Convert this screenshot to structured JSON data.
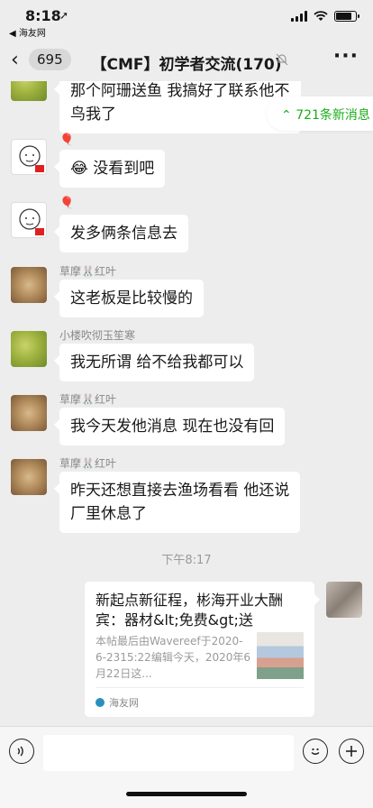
{
  "status_bar": {
    "time": "8:18",
    "location_icon": "location-arrow-icon",
    "back_app": "◀ 海友网",
    "battery_level": 0.8
  },
  "nav": {
    "back_icon": "chevron-left-icon",
    "unread_count": "695",
    "title": "【CMF】初学者交流(170)",
    "mute_icon": "bell-off-icon",
    "more_icon": "more-dots-icon"
  },
  "new_messages": "721条新消息",
  "messages": [
    {
      "sender": "",
      "text": "那个阿珊送鱼 我搞好了联系他不鸟我了"
    },
    {
      "sender": "",
      "text": "没看到吧",
      "emoji": "😂"
    },
    {
      "sender": "",
      "text": "发多俩条信息去"
    },
    {
      "sender": "草摩🐰红叶",
      "text": "这老板是比较慢的"
    },
    {
      "sender": "小楼吹彻玉笙寒",
      "text": "我无所谓 给不给我都可以"
    },
    {
      "sender": "草摩🐰红叶",
      "text": "我今天发他消息 现在也没有回"
    },
    {
      "sender": "草摩🐰红叶",
      "text_line1": "昨天还想直接去渔场看看 他还说",
      "text_line2": "厂里休息了"
    }
  ],
  "timestamp": "下午8:17",
  "link_card": {
    "title": "新起点新征程，彬海开业大酬宾：器材&lt;免费&gt;送",
    "description": "本帖最后由Wavereef于2020-6-2315:22编辑今天，2020年6月22日这...",
    "source": "海友网"
  },
  "input_bar": {
    "voice_icon": "voice-icon",
    "emoji_icon": "smiley-icon",
    "plus_icon": "plus-icon"
  },
  "colors": {
    "background": "#ededed",
    "accent_green": "#1aad19",
    "bubble": "#ffffff"
  }
}
